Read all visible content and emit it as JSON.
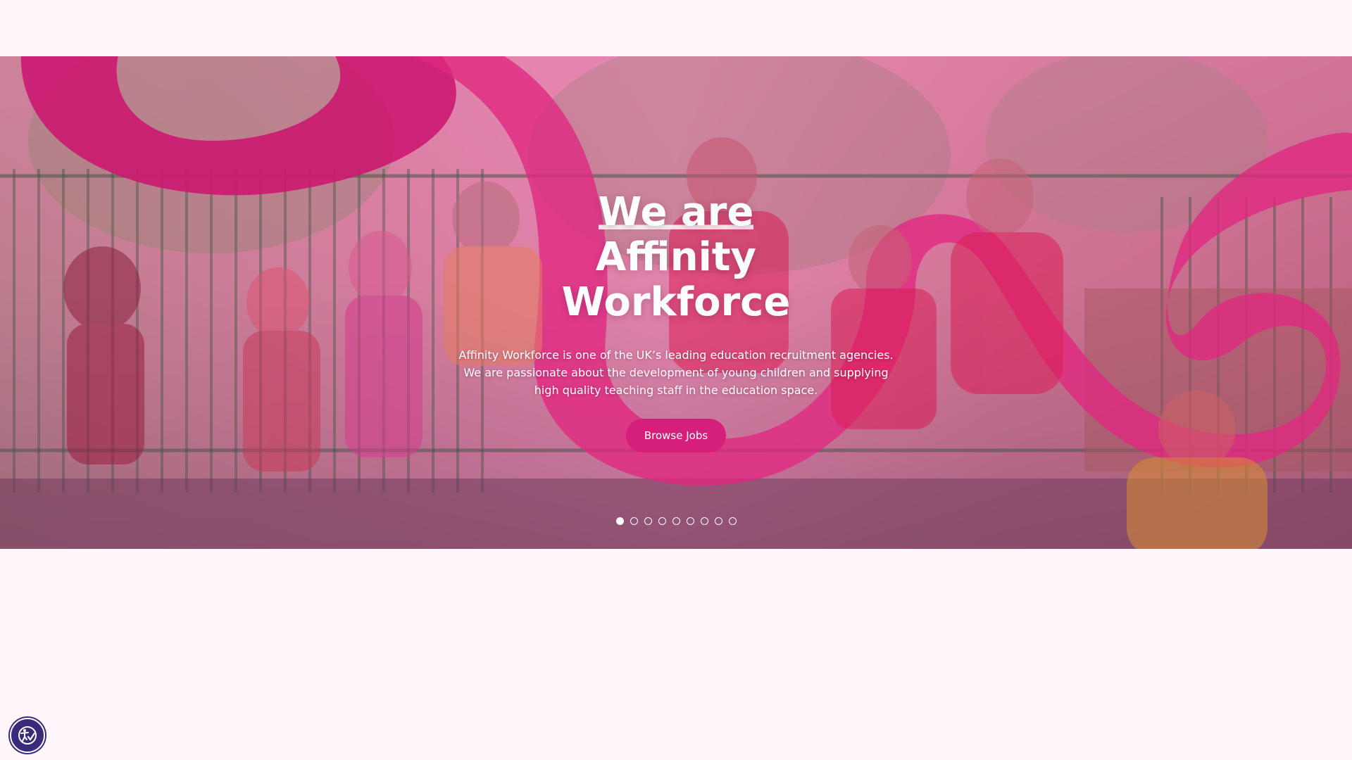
{
  "hero": {
    "title_highlight": "We are",
    "title_rest": "Affinity Workforce",
    "description": "Affinity Workforce is one of the UK’s leading education recruitment agencies. We are passionate about the development of young children and supplying high quality teaching staff in the education space.",
    "cta_label": "Browse Jobs",
    "slide_count": 9,
    "active_slide": 1
  },
  "colors": {
    "brand_pink": "#d61f7a",
    "ribbon_pink": "#c8126d",
    "a11y_button": "#3b2a7a"
  },
  "icons": {
    "accessibility": "accessibility-icon"
  }
}
